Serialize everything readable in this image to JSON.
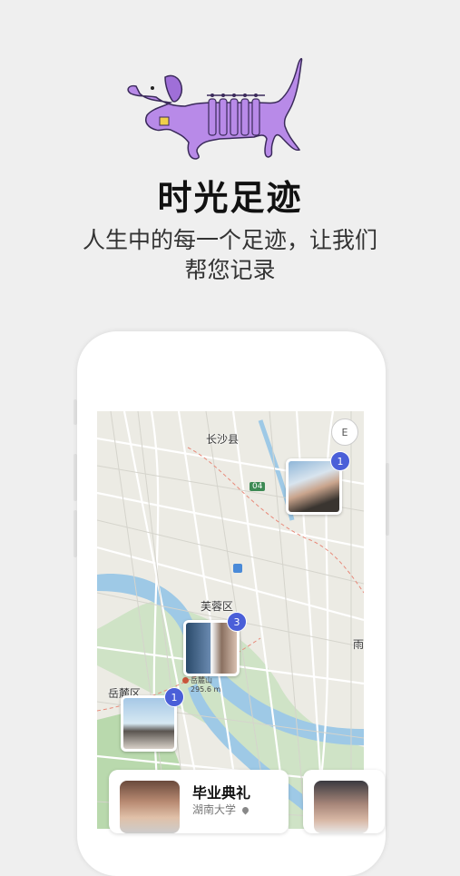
{
  "hero": {
    "title": "时光足迹",
    "subtitle": "人生中的每一个足迹，让我们帮您记录",
    "mascot_icon": "purple-dachshund-icon",
    "mascot_color": "#b88ae8"
  },
  "map": {
    "labels": {
      "county": "长沙县",
      "district_furong": "芙蓉区",
      "district_yuelu": "岳麓区",
      "edge": "雨",
      "road_badge": "04"
    },
    "compass_label": "E",
    "poi": {
      "name": "岳麓山",
      "elevation": "295.6 m"
    },
    "pins": [
      {
        "count": "1"
      },
      {
        "count": "3"
      },
      {
        "count": "1"
      }
    ],
    "badge_color": "#4a5fd8"
  },
  "events": [
    {
      "title": "毕业典礼",
      "place": "湖南大学"
    }
  ]
}
